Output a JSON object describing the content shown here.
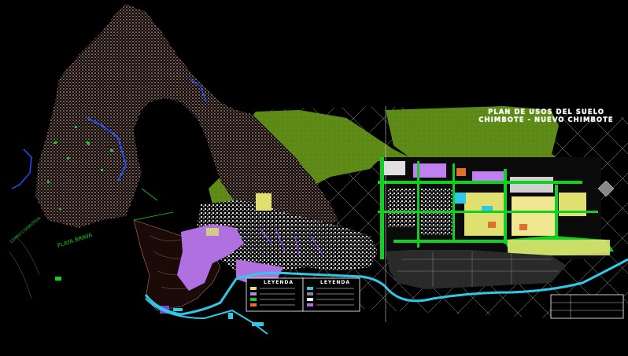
{
  "map": {
    "title_line1": "PLAN DE USOS DEL SUELO",
    "title_line2": "CHIMBOTE - NUEVO CHIMBOTE",
    "labels": {
      "playa_brava": "PLAYA BRAVA",
      "cerro_label": "CERRO COSMOTEIA"
    },
    "legend_headers": [
      "LEYENDA",
      "LEYENDA"
    ],
    "colors": {
      "background": "#000000",
      "urban_pink": "#e8a08c",
      "green_zone": "#5d8a17",
      "purple_zone": "#b070e0",
      "yellow_zone": "#e0e070",
      "cyan_coast": "#30c8e8",
      "bright_green": "#10d020",
      "grid_white": "#ffffff"
    }
  }
}
